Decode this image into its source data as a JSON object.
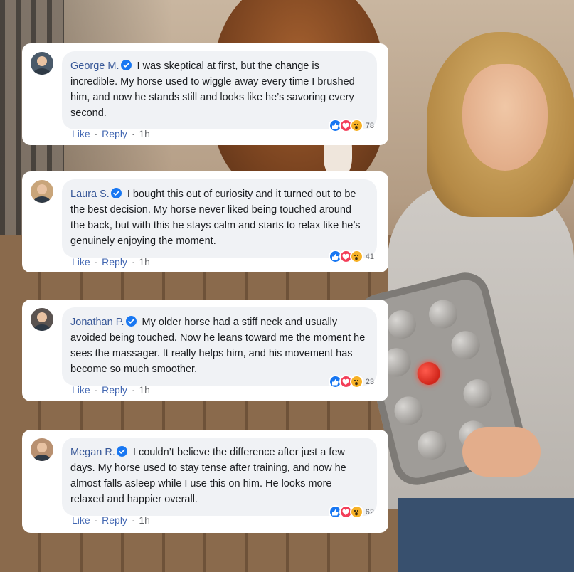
{
  "comments": [
    {
      "name": "George M.",
      "text": "I was skeptical at first, but the change is incredible. My horse used to wiggle away every time I brushed him, and now he stands still and looks like he’s savoring every second.",
      "reaction_count": "78",
      "like_label": "Like",
      "reply_label": "Reply",
      "time": "1h",
      "avatar_color": "#4a5a6a"
    },
    {
      "name": "Laura S.",
      "text": "I bought this out of curiosity and it turned out to be the best decision. My horse never liked being touched around the back, but with this he stays calm and starts to relax like he’s genuinely enjoying the moment.",
      "reaction_count": "41",
      "like_label": "Like",
      "reply_label": "Reply",
      "time": "1h",
      "avatar_color": "#c9a57a"
    },
    {
      "name": "Jonathan P.",
      "text": "My older horse had a stiff neck and usually avoided being touched. Now he leans toward me the moment he sees the massager. It really helps him, and his movement has become so much smoother.",
      "reaction_count": "23",
      "like_label": "Like",
      "reply_label": "Reply",
      "time": "1h",
      "avatar_color": "#5a5350"
    },
    {
      "name": "Megan R.",
      "text": "I couldn’t believe the difference after just a few days. My horse used to stay tense after training, and now he almost falls asleep while I use this on him. He looks more relaxed and happier overall.",
      "reaction_count": "62",
      "like_label": "Like",
      "reply_label": "Reply",
      "time": "1h",
      "avatar_color": "#b89070"
    }
  ],
  "reaction_icons": [
    "like-icon",
    "love-icon",
    "wow-icon"
  ],
  "colors": {
    "name": "#385898",
    "action_link": "#4267b2",
    "bubble": "#f0f2f5",
    "verified": "#1877f2",
    "like": "#1877f2",
    "love": "#f33e58",
    "wow": "#f7b125"
  }
}
